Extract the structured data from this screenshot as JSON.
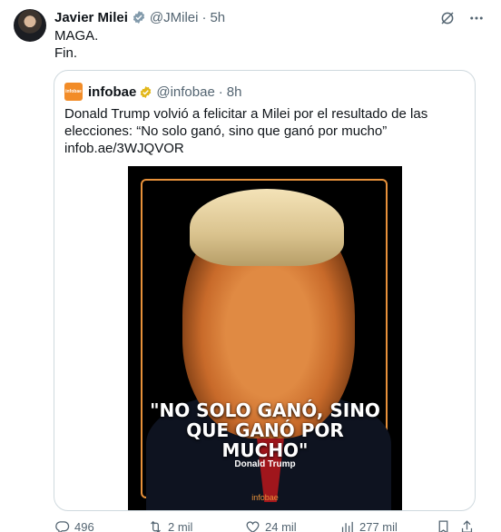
{
  "author": {
    "name": "Javier Milei",
    "handle": "@JMilei",
    "time": "5h",
    "verified_badge_icon": "gray-check-badge-icon"
  },
  "top_icons": [
    "grok-icon",
    "more-icon"
  ],
  "tweet": {
    "line1": "MAGA.",
    "line2": "Fin."
  },
  "quote": {
    "name": "infobae",
    "logo_text": "infobae",
    "handle": "@infobae",
    "time": "8h",
    "text": "Donald Trump volvió a felicitar a Milei por el resultado de las elecciones: “No solo ganó, sino que ganó por mucho” infob.ae/3WJQVOR",
    "image": {
      "quote_line1": "\"NO SOLO GANÓ, SINO",
      "quote_line2": "QUE GANÓ POR",
      "quote_line3": "MUCHO\"",
      "attribution": "Donald Trump",
      "brand": "infobae"
    }
  },
  "actions": {
    "replies": "496",
    "reposts": "2 mil",
    "likes": "24 mil",
    "views": "277 mil"
  },
  "colors": {
    "text": "#0f1419",
    "secondary": "#536471",
    "border": "#cfd9de",
    "infobae_orange": "#f28c28",
    "badge_gold": "#e2b719"
  }
}
